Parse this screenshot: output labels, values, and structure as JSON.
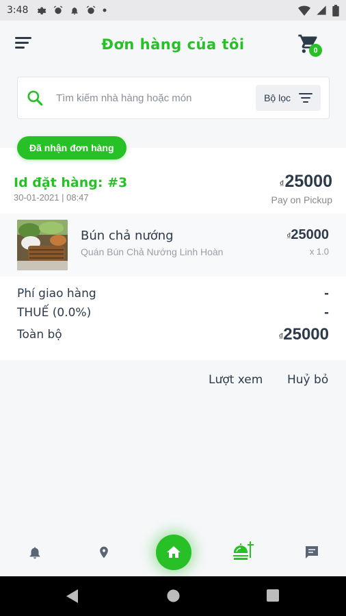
{
  "status_bar": {
    "time": "3:48"
  },
  "header": {
    "title": "Đơn hàng của tôi",
    "cart_count": "0"
  },
  "search": {
    "placeholder": "Tìm kiếm nhà hàng hoặc món",
    "filter_label": "Bộ lọc"
  },
  "order_status": "Đã nhận đơn hàng",
  "order": {
    "id_label": "Id đặt hàng: #3",
    "datetime": "30-01-2021 | 08:47",
    "currency": "₫",
    "total": "25000",
    "payment_method": "Pay on Pickup",
    "items": [
      {
        "name": "Bún chả nướng",
        "restaurant": "Quán Bún Chả Nướng Linh Hoàn",
        "price": "25000",
        "quantity": "x 1.0"
      }
    ],
    "summary": {
      "delivery_fee_label": "Phí giao hàng",
      "delivery_fee_value": "-",
      "tax_label": "THUẾ (0.0%)",
      "tax_value": "-",
      "total_label": "Toàn bộ",
      "total_value": "25000"
    }
  },
  "actions": {
    "view": "Lượt xem",
    "cancel": "Huỷ bỏ"
  },
  "bottom_nav": [
    "bell-icon",
    "location-pin-icon",
    "home-icon",
    "food-order-icon",
    "chat-icon"
  ],
  "colors": {
    "accent": "#27c127",
    "text_dark": "#2d3a4a"
  }
}
